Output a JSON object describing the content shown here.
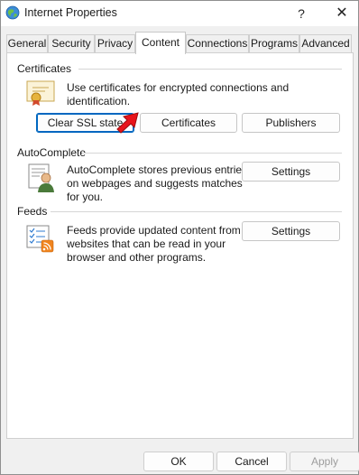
{
  "window": {
    "title": "Internet Properties",
    "help_glyph": "?",
    "close_glyph": "✕"
  },
  "tabs": [
    {
      "label": "General"
    },
    {
      "label": "Security"
    },
    {
      "label": "Privacy"
    },
    {
      "label": "Content",
      "active": true
    },
    {
      "label": "Connections"
    },
    {
      "label": "Programs"
    },
    {
      "label": "Advanced"
    }
  ],
  "certificates": {
    "header": "Certificates",
    "description": "Use certificates for encrypted connections and identification.",
    "clear_ssl_label": "Clear SSL state",
    "certificates_label": "Certificates",
    "publishers_label": "Publishers"
  },
  "autocomplete": {
    "header": "AutoComplete",
    "description_lines": [
      "AutoComplete stores previous entries",
      "on webpages and suggests matches",
      "for you."
    ],
    "settings_label": "Settings"
  },
  "feeds": {
    "header": "Feeds",
    "description_lines": [
      "Feeds provide updated content from",
      "websites that can be read in your",
      "browser and other programs."
    ],
    "settings_label": "Settings"
  },
  "footer": {
    "ok_label": "OK",
    "cancel_label": "Cancel",
    "apply_label": "Apply"
  },
  "colors": {
    "annotation_arrow": "#e8141b",
    "focus_border": "#0067c0"
  }
}
